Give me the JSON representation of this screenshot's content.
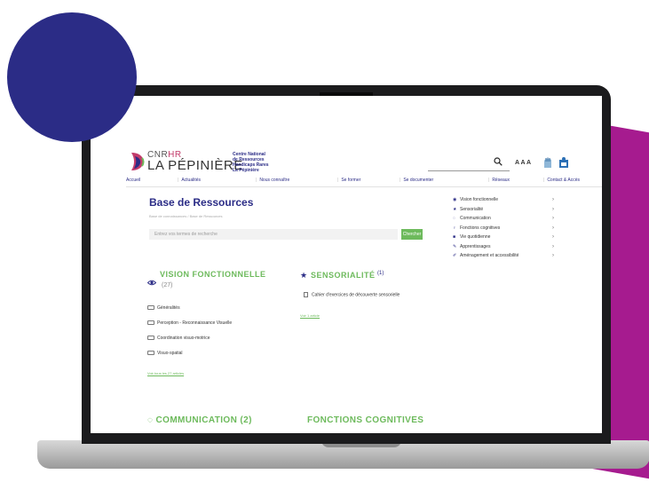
{
  "colors": {
    "navy": "#2b2c86",
    "green": "#6dba5c",
    "magenta": "#a61b8f",
    "logo_red": "#c23b6a"
  },
  "header": {
    "brand_line1_prefix": "CNR",
    "brand_line1_suffix": "HR",
    "brand_line2": "LA PÉPINIÈRE",
    "brand_sub": [
      "Centre National",
      "de Ressources",
      "Handicaps Rares",
      "La Pépinière"
    ],
    "text_size_label": "A A A",
    "icons": [
      "search-icon",
      "sign-language-icon",
      "easy-read-icon"
    ]
  },
  "nav": {
    "items": [
      "Accueil",
      "Actualités",
      "Nous connaître",
      "Se former",
      "Se documenter",
      "Réseaux",
      "Contact & Accès"
    ]
  },
  "page": {
    "title": "Base de Ressources",
    "breadcrumb": "Base de connaissances / Base de Ressources",
    "search_placeholder": "Entrez vos termes de recherche",
    "search_button": "Chercher"
  },
  "sidebar": {
    "items": [
      {
        "label": "Vision fonctionnelle",
        "icon": "eye-icon"
      },
      {
        "label": "Sensorialité",
        "icon": "star-icon"
      },
      {
        "label": "Communication",
        "icon": "chat-icon"
      },
      {
        "label": "Fonctions cognitives",
        "icon": "bulb-icon"
      },
      {
        "label": "Vie quotidienne",
        "icon": "home-icon"
      },
      {
        "label": "Apprentissages",
        "icon": "pencil-icon"
      },
      {
        "label": "Aménagement et accessibilité",
        "icon": "wrench-icon"
      }
    ]
  },
  "sections": {
    "vision": {
      "title": "VISION FONCTIONNELLE",
      "count": "(27)",
      "items": [
        "Généralités",
        "Perception - Reconnaissance Visuelle",
        "Coordination visuo-motrice",
        "Visuo-spatial"
      ],
      "see_all": "Voir tous les 27 articles"
    },
    "sensorialite": {
      "title": "SENSORIALITÉ",
      "count": "(1)",
      "article": "Cahier d'exercices de découverte sensorielle",
      "see_all": "Voir 1 article"
    },
    "communication": {
      "title": "COMMUNICATION",
      "count": "(2)"
    },
    "cognitives": {
      "title": "FONCTIONS COGNITIVES"
    }
  }
}
